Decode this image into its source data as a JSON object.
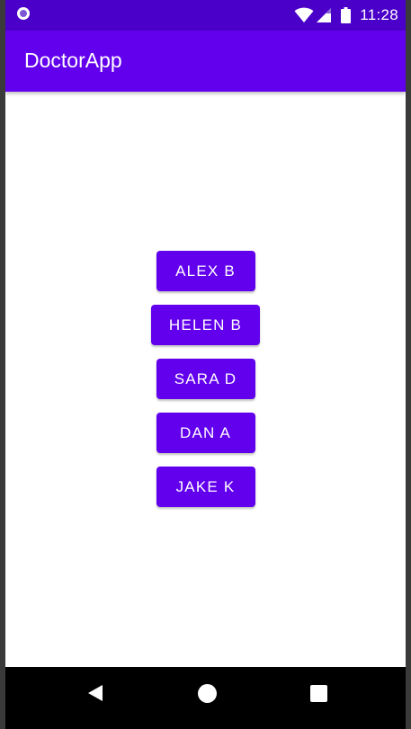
{
  "status_bar": {
    "time": "11:28",
    "icons": [
      "notification-icon",
      "wifi-icon",
      "signal-icon",
      "battery-icon"
    ]
  },
  "app_bar": {
    "title": "DoctorApp"
  },
  "doctors": [
    {
      "label": "ALEX B"
    },
    {
      "label": "HELEN B"
    },
    {
      "label": "SARA D"
    },
    {
      "label": "DAN A"
    },
    {
      "label": "JAKE K"
    }
  ],
  "nav_bar": {
    "icons": [
      "back-icon",
      "home-icon",
      "recents-icon"
    ]
  },
  "colors": {
    "status_bar": "#4a00c9",
    "primary": "#6200ee",
    "background": "#ffffff",
    "nav_bar": "#000000",
    "on_primary": "#ffffff"
  }
}
